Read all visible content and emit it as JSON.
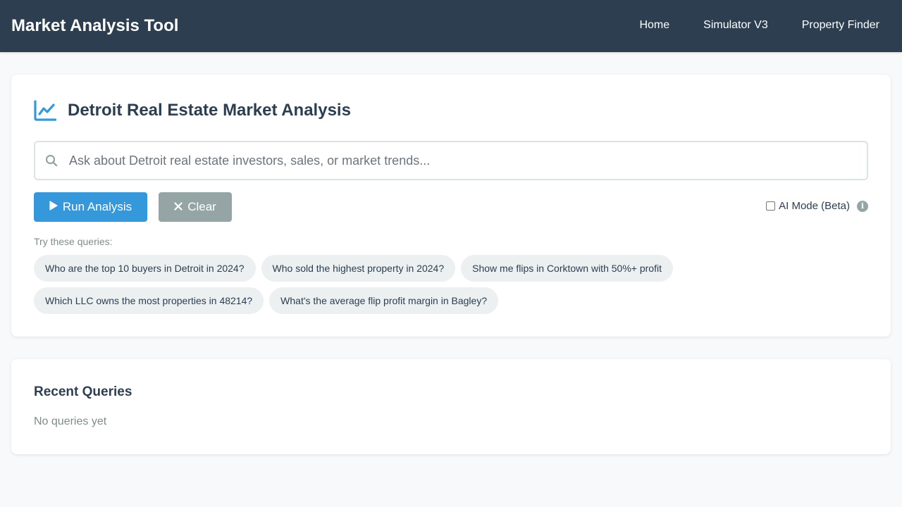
{
  "navbar": {
    "brand": "Market Analysis Tool",
    "links": [
      "Home",
      "Simulator V3",
      "Property Finder"
    ]
  },
  "main": {
    "title": "Detroit Real Estate Market Analysis",
    "title_icon": "line-chart-icon",
    "search": {
      "placeholder": "Ask about Detroit real estate investors, sales, or market trends...",
      "value": "",
      "icon": "search-icon"
    },
    "run_button": "Run Analysis",
    "clear_button": "Clear",
    "ai_mode": {
      "label": "AI Mode (Beta)",
      "checked": false
    },
    "try_label": "Try these queries:",
    "suggestions": [
      "Who are the top 10 buyers in Detroit in 2024?",
      "Who sold the highest property in 2024?",
      "Show me flips in Corktown with 50%+ profit",
      "Which LLC owns the most properties in 48214?",
      "What's the average flip profit margin in Bagley?"
    ]
  },
  "recent": {
    "title": "Recent Queries",
    "empty_text": "No queries yet"
  },
  "colors": {
    "navbar": "#2c3e50",
    "accent": "#3498db",
    "clear": "#95a5a6",
    "chip": "#ecf0f1"
  }
}
